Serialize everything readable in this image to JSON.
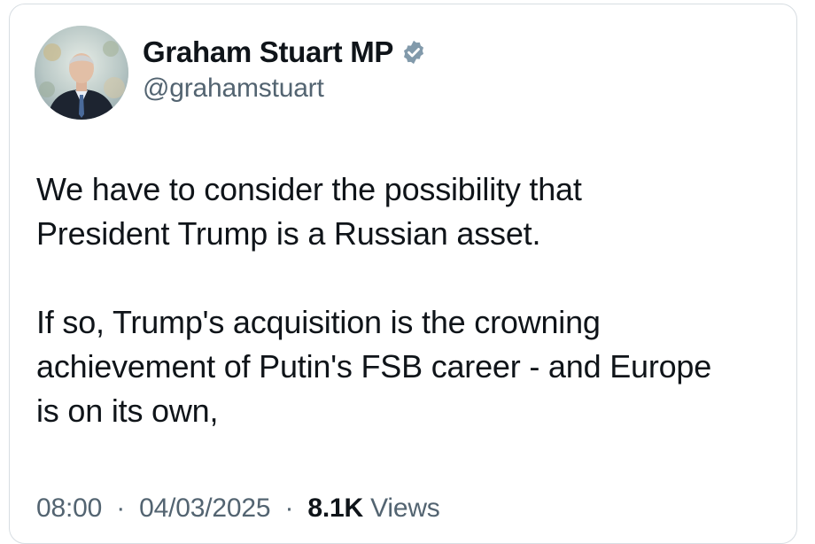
{
  "author": {
    "display_name": "Graham Stuart MP",
    "handle": "@grahamstuart",
    "verified_icon": "verified-badge-icon",
    "verified_color": "#829aab"
  },
  "tweet": {
    "paragraphs": [
      "We have to consider the possibility that\nPresident Trump is a Russian asset.",
      "If so, Trump's acquisition is the crowning\nachievement of Putin's FSB career - and  Europe\nis on its own,"
    ]
  },
  "meta": {
    "time": "08:00",
    "date": "04/03/2025",
    "views_count": "8.1K",
    "views_label": "Views",
    "separator": "·"
  }
}
